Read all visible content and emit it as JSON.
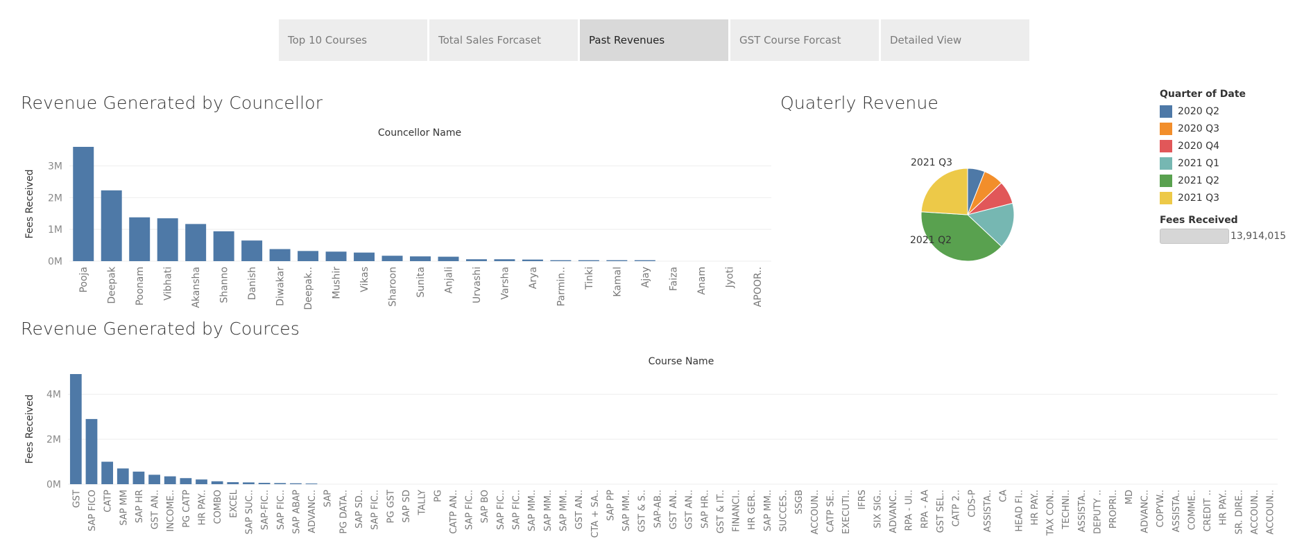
{
  "tabs": [
    "Top 10 Courses",
    "Total Sales Forcaset",
    "Past Revenues",
    "GST Course Forcast",
    "Detailed View"
  ],
  "active_tab": 2,
  "counsellor_title": "Revenue Generated by Councellor",
  "courses_title": "Revenue Generated by Cources",
  "pie_title": "Quaterly Revenue",
  "legend": {
    "title": "Quarter of Date",
    "items": [
      {
        "label": "2020 Q2",
        "color": "#4e79a7"
      },
      {
        "label": "2020 Q3",
        "color": "#f28e2b"
      },
      {
        "label": "2020 Q4",
        "color": "#e15759"
      },
      {
        "label": "2021 Q1",
        "color": "#76b7b2"
      },
      {
        "label": "2021 Q2",
        "color": "#59a14f"
      },
      {
        "label": "2021 Q3",
        "color": "#edc948"
      }
    ],
    "fees_title": "Fees Received",
    "fees_value": "13,914,015"
  },
  "chart_data": [
    {
      "type": "bar",
      "title": "Revenue Generated by Councellor",
      "xlabel": "Councellor Name",
      "ylabel": "Fees Received",
      "ylim": [
        0,
        3600000
      ],
      "yticks": [
        0,
        1000000,
        2000000,
        3000000
      ],
      "ytick_labels": [
        "0M",
        "1M",
        "2M",
        "3M"
      ],
      "color": "#4e79a7",
      "categories": [
        "Pooja",
        "Deepak",
        "Poonam",
        "Vibhati",
        "Akansha",
        "Shanno",
        "Danish",
        "Diwakar",
        "Deepak..",
        "Mushir",
        "Vikas",
        "Sharoon",
        "Sunita",
        "Anjali",
        "Urvashi",
        "Varsha",
        "Arya",
        "Parmin..",
        "Tinki",
        "Kamal",
        "Ajay",
        "Faiza",
        "Anam",
        "Jyoti",
        "APOOR.."
      ],
      "values": [
        3600000,
        2230000,
        1380000,
        1350000,
        1170000,
        940000,
        650000,
        380000,
        320000,
        300000,
        270000,
        170000,
        150000,
        140000,
        60000,
        60000,
        50000,
        30000,
        30000,
        30000,
        30000,
        0,
        0,
        0,
        0
      ]
    },
    {
      "type": "bar",
      "title": "Revenue Generated by Cources",
      "xlabel": "Course Name",
      "ylabel": "Fees Received",
      "ylim": [
        0,
        4900000
      ],
      "yticks": [
        0,
        2000000,
        4000000
      ],
      "ytick_labels": [
        "0M",
        "2M",
        "4M"
      ],
      "color": "#4e79a7",
      "categories": [
        "GST",
        "SAP FICO",
        "CATP",
        "SAP MM",
        "SAP HR",
        "GST AN..",
        "INCOME..",
        "PG CATP",
        "HR PAY..",
        "COMBO",
        "EXCEL",
        "SAP SUC..",
        "SAP-FIC..",
        "SAP FIC..",
        "SAP ABAP",
        "ADVANC..",
        "SAP",
        "PG DATA..",
        "SAP SD..",
        "SAP FIC..",
        "PG GST",
        "SAP SD",
        "TALLY",
        "PG",
        "CATP AN..",
        "SAP FIC..",
        "SAP BO",
        "SAP FIC..",
        "SAP FIC..",
        "SAP MM..",
        "SAP MM..",
        "SAP MM..",
        "GST AN..",
        "CTA + SA..",
        "SAP PP",
        "SAP MM..",
        "GST & S..",
        "SAP-AB..",
        "GST AN..",
        "GST AN..",
        "SAP HR..",
        "GST & IT..",
        "FINANCI..",
        "HR GER..",
        "SAP MM..",
        "SUCCES..",
        "SSGB",
        "ACCOUN..",
        "CATP SE..",
        "EXECUTI..",
        "IFRS",
        "SIX SIG..",
        "ADVANC..",
        "RPA - UI..",
        "RPA - AA",
        "GST SEL..",
        "CATP 2..",
        "CDS-P",
        "ASSISTA..",
        "CA",
        "HEAD FI..",
        "HR PAY..",
        "TAX CON..",
        "TECHNI..",
        "ASSISTA..",
        "DEPUTY ..",
        "PROPRI..",
        "MD",
        "ADVANC..",
        "COPYW..",
        "ASSISTA..",
        "COMME..",
        "CREDIT ..",
        "HR PAY..",
        "SR. DIRE..",
        "ACCOUN..",
        "ACCOUN.."
      ],
      "values": [
        4900000,
        2900000,
        1000000,
        700000,
        560000,
        420000,
        350000,
        270000,
        210000,
        130000,
        90000,
        80000,
        60000,
        50000,
        40000,
        30000,
        0,
        0,
        0,
        0,
        0,
        0,
        0,
        0,
        0,
        0,
        0,
        0,
        0,
        0,
        0,
        0,
        0,
        0,
        0,
        0,
        0,
        0,
        0,
        0,
        0,
        0,
        0,
        0,
        0,
        0,
        0,
        0,
        0,
        0,
        0,
        0,
        0,
        0,
        0,
        0,
        0,
        0,
        0,
        0,
        0,
        0,
        0,
        0,
        0,
        0,
        0,
        0,
        0,
        0,
        0,
        0,
        0,
        0,
        0,
        0,
        0
      ]
    },
    {
      "type": "pie",
      "title": "Quaterly Revenue",
      "categories": [
        "2020 Q2",
        "2020 Q3",
        "2020 Q4",
        "2021 Q1",
        "2021 Q2",
        "2021 Q3"
      ],
      "values": [
        0.06,
        0.07,
        0.08,
        0.16,
        0.39,
        0.24
      ],
      "colors": [
        "#4e79a7",
        "#f28e2b",
        "#e15759",
        "#76b7b2",
        "#59a14f",
        "#edc948"
      ],
      "labels": [
        "",
        "2020 Q3",
        "2020 Q4",
        "2021 Q1",
        "2021 Q2",
        "2021 Q3"
      ]
    }
  ]
}
